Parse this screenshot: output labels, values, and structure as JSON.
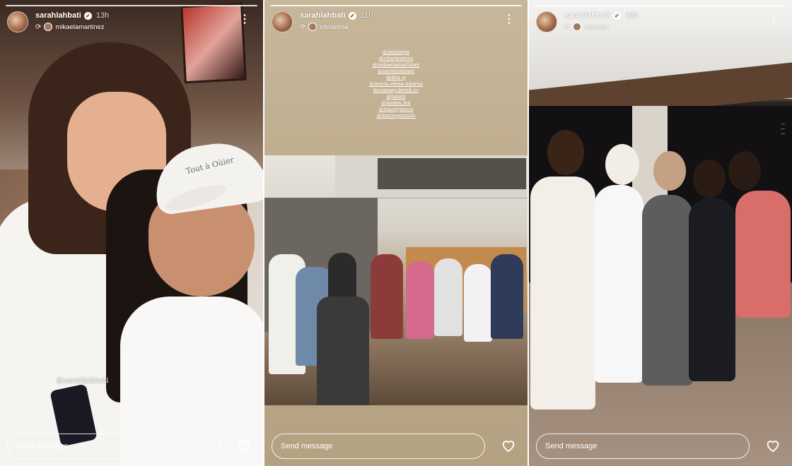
{
  "stories": [
    {
      "username": "sarahlahbati",
      "time": "13h",
      "reposted_from": "mikaelamartinez",
      "mention": "@sarahlahbati",
      "cap_text": "Tout à Oùier",
      "message_placeholder": "Send message"
    },
    {
      "username": "sarahlahbati",
      "time": "11h",
      "reposted_from": "vitoselma",
      "tagged": [
        "@mimiegu",
        "@charlesrevs",
        "@mikaelamartinez",
        "@sarahlahbati",
        "@dra_g",
        "@maria.elena.adarna",
        "@ramsey.derek.cc",
        "@jazelz",
        "@jaiden.lee",
        "@staceyjanco",
        "@mariegonzalo"
      ],
      "message_placeholder": "Send message"
    },
    {
      "username": "sarahlahbati",
      "time": "10h",
      "reposted_from": "mimegu",
      "message_placeholder": "Send message"
    }
  ],
  "icons": {
    "verified": "verified-badge-icon",
    "repost": "repost-icon",
    "more": "more-options-icon",
    "like": "heart-icon"
  }
}
